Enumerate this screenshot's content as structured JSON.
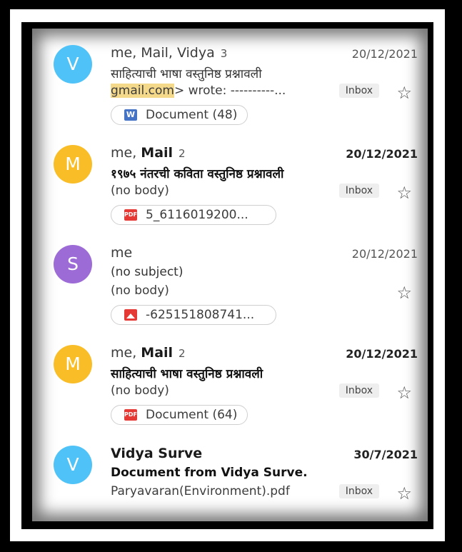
{
  "emails": [
    {
      "avatar_letter": "V",
      "avatar_color": "#4fc3f7",
      "sender_plain": "me, Mail, Vidya",
      "sender_bold": "",
      "count": "3",
      "date": "20/12/2021",
      "subject": "साहित्याची भाषा वस्तुनिष्ठ प्रश्नावली",
      "snippet_highlight": "gmail.com",
      "snippet_rest": "> wrote: ----------...",
      "label": "Inbox",
      "attachment": {
        "type": "word",
        "icon_text": "W",
        "name": "Document (48)"
      }
    },
    {
      "avatar_letter": "M",
      "avatar_color": "#f9bd28",
      "sender_plain": "me, ",
      "sender_bold": "Mail",
      "count": "2",
      "date": "20/12/2021",
      "subject": "१९७५ नंतरची कविता वस्तुनिष्ठ प्रश्नावली",
      "snippet": "(no body)",
      "label": "Inbox",
      "attachment": {
        "type": "pdf",
        "icon_text": "PDF",
        "name": "5_6116019200..."
      }
    },
    {
      "avatar_letter": "S",
      "avatar_color": "#9c6bd6",
      "sender_plain": "me",
      "count": "",
      "date": "20/12/2021",
      "subject": "(no subject)",
      "snippet": "(no body)",
      "attachment": {
        "type": "image",
        "icon_text": "",
        "name": "-625151808741..."
      }
    },
    {
      "avatar_letter": "M",
      "avatar_color": "#f9bd28",
      "sender_plain": "me, ",
      "sender_bold": "Mail",
      "count": "2",
      "date": "20/12/2021",
      "subject": "साहित्याची  भाषा वस्तुनिष्ठ प्रश्नावली",
      "snippet": "(no body)",
      "label": "Inbox",
      "attachment": {
        "type": "pdf",
        "icon_text": "PDF",
        "name": "Document (64)"
      }
    },
    {
      "avatar_letter": "V",
      "avatar_color": "#4fc3f7",
      "sender_bold": "Vidya Surve",
      "date": "30/7/2021",
      "subject": "Document from Vidya Surve.",
      "snippet": "Paryavaran(Environment).pdf",
      "label": "Inbox"
    }
  ],
  "icons": {
    "star": "☆",
    "star_icon_name": "star-icon",
    "word_icon_name": "word-doc-icon",
    "pdf_icon_name": "pdf-icon",
    "image_icon_name": "image-icon"
  }
}
